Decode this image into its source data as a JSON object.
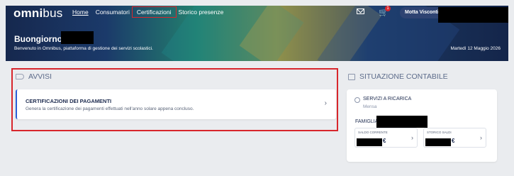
{
  "header": {
    "logo_bold": "omni",
    "logo_light": "bus",
    "nav": [
      "Home",
      "Consumatori",
      "Certificazioni",
      "Storico presenze"
    ],
    "cart_badge": "1",
    "user_button": "Motta Visconti",
    "greeting": "Buongiorno",
    "welcome": "Benvenuto in Omnibus, piattaforma di gestione dei servizi scolastici.",
    "date": "Martedì 12 Maggio 2026",
    "icons": [
      "mail-icon",
      "cart-icon"
    ],
    "colors": {
      "highlight": "#d8262c",
      "badge": "#d8262c",
      "user_button": "#2e4372"
    }
  },
  "avvisi": {
    "title": "AVVISI",
    "icon": "megaphone-icon",
    "card": {
      "title": "CERTIFICAZIONI DEI PAGAMENTI",
      "description": "Genera la certificazione dei pagamenti effettuati nell'anno solare appena concluso."
    }
  },
  "situazione": {
    "title": "SITUAZIONE CONTABILE",
    "icon": "wallet-icon",
    "service_title": "SERVIZI A RICARICA",
    "service_sub": "Mensa",
    "family_label": "FAMIGLIA:",
    "accounts": [
      {
        "label": "SALDO CORRENTE",
        "currency": "€"
      },
      {
        "label": "STORICO SALDI",
        "currency": "€"
      }
    ]
  }
}
